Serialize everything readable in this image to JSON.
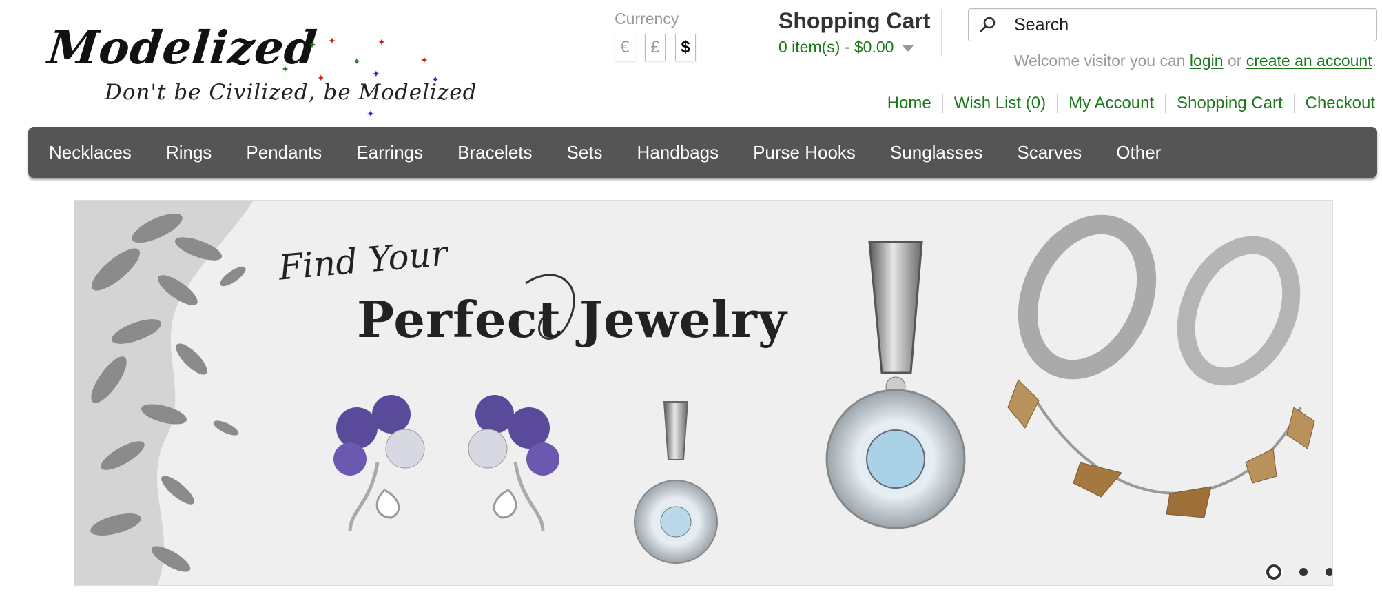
{
  "logo": {
    "title": "Modelized",
    "tagline": "Don't be Civilized, be Modelized"
  },
  "currency": {
    "label": "Currency",
    "options": [
      "€",
      "£",
      "$"
    ],
    "selected": "$"
  },
  "cart": {
    "title": "Shopping Cart",
    "summary": "0 item(s) - $0.00"
  },
  "search": {
    "placeholder": "Search"
  },
  "welcome": {
    "prefix": "Welcome visitor you can",
    "login": "login",
    "or": "or",
    "create": "create an account",
    "suffix": "."
  },
  "toplinks": [
    "Home",
    "Wish List (0)",
    "My Account",
    "Shopping Cart",
    "Checkout"
  ],
  "menu": [
    "Necklaces",
    "Rings",
    "Pendants",
    "Earrings",
    "Bracelets",
    "Sets",
    "Handbags",
    "Purse Hooks",
    "Sunglasses",
    "Scarves",
    "Other"
  ],
  "banner": {
    "line1": "Find Your",
    "line2": "Perfect Jewelry",
    "slide_count": 3,
    "active_slide": 1
  },
  "colors": {
    "link_green": "#1a7a1a",
    "menu_bg": "#555555"
  }
}
